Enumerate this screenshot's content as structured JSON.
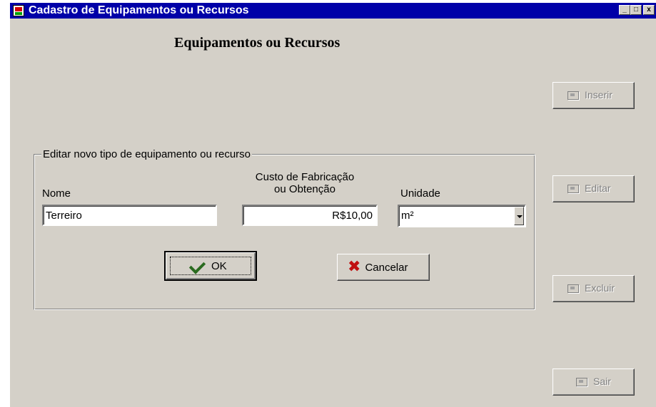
{
  "window": {
    "title": "Cadastro de Equipamentos ou Recursos",
    "minimize_glyph": "_",
    "maximize_glyph": "□",
    "close_glyph": "x"
  },
  "heading": "Equipamentos ou Recursos",
  "group": {
    "legend": "Editar novo tipo de equipamento ou recurso",
    "nome_label": "Nome",
    "nome_value": "Terreiro",
    "custo_label_line1": "Custo de Fabricação",
    "custo_label_line2": "ou Obtenção",
    "custo_value": "R$10,00",
    "unidade_label": "Unidade",
    "unidade_value": "m²"
  },
  "buttons": {
    "ok": "OK",
    "cancelar": "Cancelar",
    "inserir": "Inserir",
    "editar": "Editar",
    "excluir": "Excluir",
    "sair": "Sair"
  },
  "icons": {
    "ok": "check-icon",
    "cancelar": "x-icon",
    "inserir": "insert-icon",
    "editar": "edit-icon",
    "excluir": "delete-icon",
    "sair": "exit-icon"
  },
  "colors": {
    "titlebar": "#0000a8",
    "face": "#d4d0c8",
    "check": "#2a6b1f",
    "cancel_x": "#c01010"
  }
}
